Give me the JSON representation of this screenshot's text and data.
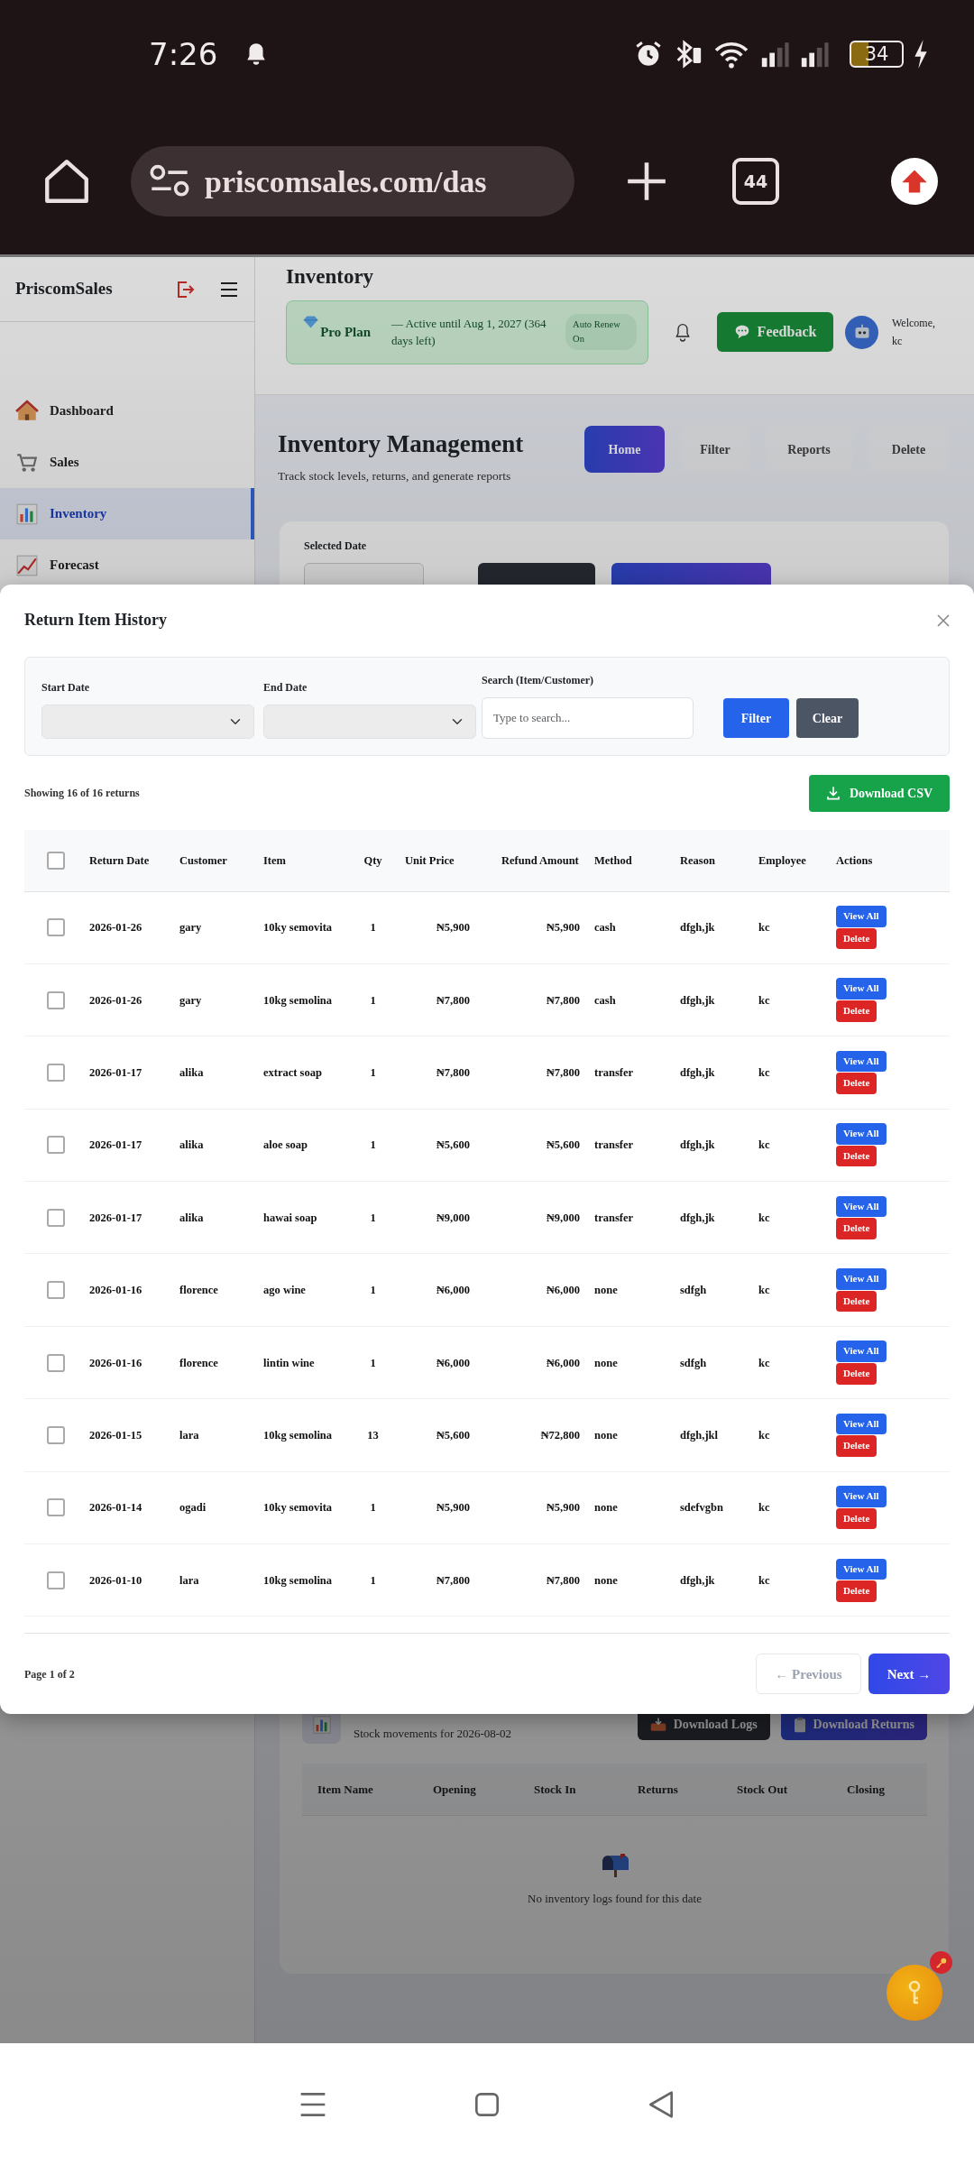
{
  "status_bar": {
    "time": "7:26",
    "battery": "34"
  },
  "browser": {
    "url": "priscomsales.com/das",
    "tab_count": "44"
  },
  "sidebar": {
    "brand": "PriscomSales",
    "items": [
      {
        "label": "Dashboard",
        "selected": false
      },
      {
        "label": "Sales",
        "selected": false
      },
      {
        "label": "Inventory",
        "selected": true
      },
      {
        "label": "Forecast",
        "selected": false
      }
    ]
  },
  "header": {
    "title": "Inventory",
    "plan": {
      "name": "Pro Plan",
      "status": "— Active until Aug 1, 2027 (364 days left)",
      "renew": "Auto Renew On"
    },
    "feedback": "Feedback",
    "welcome": "Welcome, kc"
  },
  "page": {
    "title": "Inventory Management",
    "subtitle": "Track stock levels, returns, and generate reports",
    "tabs": [
      {
        "label": "Home",
        "selected": true
      },
      {
        "label": "Filter",
        "selected": false
      },
      {
        "label": "Reports",
        "selected": false
      },
      {
        "label": "Delete",
        "selected": false
      }
    ],
    "selected_date_label": "Selected Date"
  },
  "modal": {
    "title": "Return Item History",
    "filters": {
      "start_date": "Start Date",
      "end_date": "End Date",
      "search_label": "Search (Item/Customer)",
      "placeholder": "Type to search...",
      "filter": "Filter",
      "clear": "Clear"
    },
    "summary": "Showing 16 of 16 returns",
    "download": "Download CSV",
    "select_all": false,
    "columns": [
      "Return Date",
      "Customer",
      "Item",
      "Qty",
      "Unit Price",
      "Refund Amount",
      "Method",
      "Reason",
      "Employee",
      "Actions"
    ],
    "rows": [
      {
        "checked": false,
        "date": "2026-01-26",
        "customer": "gary",
        "item": "10ky semovita",
        "qty": "1",
        "unit_price": "₦5,900",
        "refund": "₦5,900",
        "method": "cash",
        "reason": "dfgh,jk",
        "employee": "kc",
        "actions": [
          "View All",
          "Delete"
        ]
      },
      {
        "checked": false,
        "date": "2026-01-26",
        "customer": "gary",
        "item": "10kg semolina",
        "qty": "1",
        "unit_price": "₦7,800",
        "refund": "₦7,800",
        "method": "cash",
        "reason": "dfgh,jk",
        "employee": "kc",
        "actions": [
          "View All",
          "Delete"
        ]
      },
      {
        "checked": false,
        "date": "2026-01-17",
        "customer": "alika",
        "item": "extract soap",
        "qty": "1",
        "unit_price": "₦7,800",
        "refund": "₦7,800",
        "method": "transfer",
        "reason": "dfgh,jk",
        "employee": "kc",
        "actions": [
          "View All",
          "Delete"
        ]
      },
      {
        "checked": false,
        "date": "2026-01-17",
        "customer": "alika",
        "item": "aloe soap",
        "qty": "1",
        "unit_price": "₦5,600",
        "refund": "₦5,600",
        "method": "transfer",
        "reason": "dfgh,jk",
        "employee": "kc",
        "actions": [
          "View All",
          "Delete"
        ]
      },
      {
        "checked": false,
        "date": "2026-01-17",
        "customer": "alika",
        "item": "hawai soap",
        "qty": "1",
        "unit_price": "₦9,000",
        "refund": "₦9,000",
        "method": "transfer",
        "reason": "dfgh,jk",
        "employee": "kc",
        "actions": [
          "View All",
          "Delete"
        ]
      },
      {
        "checked": false,
        "date": "2026-01-16",
        "customer": "florence",
        "item": "ago wine",
        "qty": "1",
        "unit_price": "₦6,000",
        "refund": "₦6,000",
        "method": "none",
        "reason": "sdfgh",
        "employee": "kc",
        "actions": [
          "View All",
          "Delete"
        ]
      },
      {
        "checked": false,
        "date": "2026-01-16",
        "customer": "florence",
        "item": "lintin wine",
        "qty": "1",
        "unit_price": "₦6,000",
        "refund": "₦6,000",
        "method": "none",
        "reason": "sdfgh",
        "employee": "kc",
        "actions": [
          "View All",
          "Delete"
        ]
      },
      {
        "checked": false,
        "date": "2026-01-15",
        "customer": "lara",
        "item": "10kg semolina",
        "qty": "13",
        "unit_price": "₦5,600",
        "refund": "₦72,800",
        "method": "none",
        "reason": "dfgh,jkl",
        "employee": "kc",
        "actions": [
          "View All",
          "Delete"
        ]
      },
      {
        "checked": false,
        "date": "2026-01-14",
        "customer": "ogadi",
        "item": "10ky semovita",
        "qty": "1",
        "unit_price": "₦5,900",
        "refund": "₦5,900",
        "method": "none",
        "reason": "sdefvgbn",
        "employee": "kc",
        "actions": [
          "View All",
          "Delete"
        ]
      },
      {
        "checked": false,
        "date": "2026-01-10",
        "customer": "lara",
        "item": "10kg semolina",
        "qty": "1",
        "unit_price": "₦7,800",
        "refund": "₦7,800",
        "method": "none",
        "reason": "dfgh,jk",
        "employee": "kc",
        "actions": [
          "View All",
          "Delete"
        ]
      }
    ],
    "page_info": "Page 1 of 2",
    "previous": {
      "label": "← Previous",
      "disabled": true
    },
    "next": {
      "label": "Next →",
      "disabled": false
    }
  },
  "logs": {
    "subtitle": "Stock movements for 2026-08-02",
    "buttons": [
      "Download Logs",
      "Download Returns"
    ],
    "columns": [
      "Item Name",
      "Opening",
      "Stock In",
      "Returns",
      "Stock Out",
      "Closing"
    ],
    "empty": "No inventory logs found for this date"
  }
}
